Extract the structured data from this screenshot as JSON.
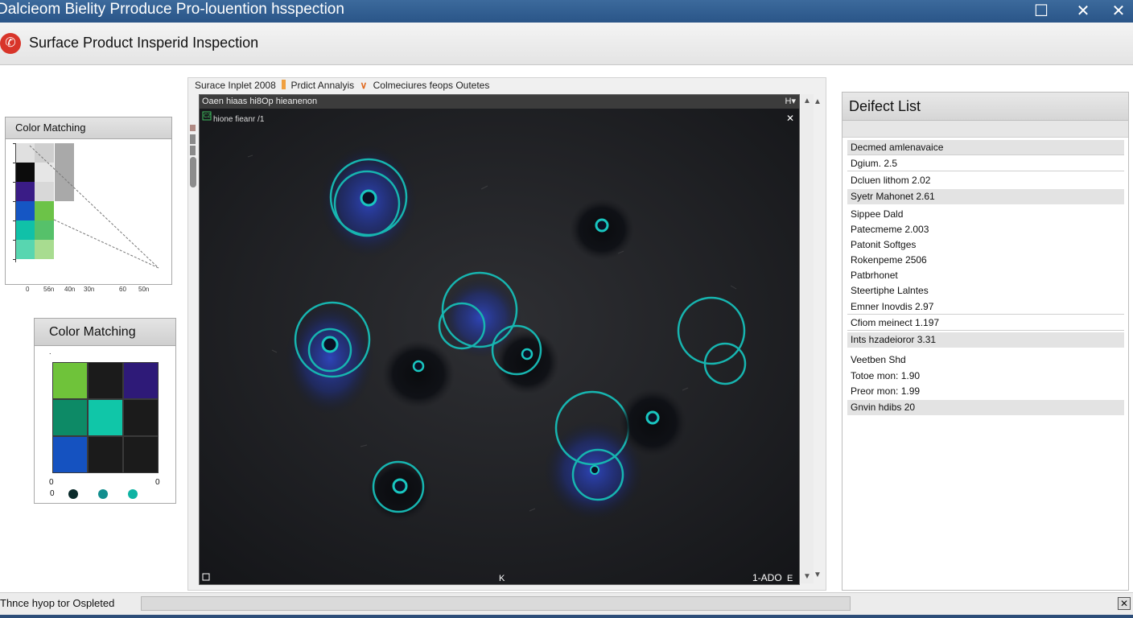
{
  "window": {
    "title": "Dalcieom Bielity Prroduce Pro-louention hsspection",
    "controls": {
      "maximize": "☐",
      "minimize": "✕",
      "close": "✕"
    }
  },
  "app": {
    "title": "Surface Product Insperid Inspection",
    "logo_icon": "phone-icon"
  },
  "color_matching_1": {
    "header": "Color Matching",
    "x_labels": [
      "0",
      "56n",
      "40n",
      "30n",
      "60",
      "50n"
    ],
    "swatches": [
      [
        "#e0e0e0",
        "#cfcfcf"
      ],
      [
        "#0c0c0c",
        "#e6e6e6"
      ],
      [
        "#3a1c86",
        "#d8d8d8"
      ],
      [
        "#1556c4",
        "#6cc348"
      ],
      [
        "#10c1a8",
        "#56c16a"
      ],
      [
        "#58d6b0",
        "#a8dc90"
      ]
    ]
  },
  "color_matching_2": {
    "header": "Color Matching",
    "axis_labels": {
      "top": ".",
      "bottom_left": "0",
      "bottom_right": "0",
      "row": "0"
    },
    "grid": [
      [
        "#6fc33a",
        "#1b1b1b",
        "#2e1a78"
      ],
      [
        "#0d8a66",
        "#10c6a8",
        "#1b1b1b"
      ],
      [
        "#1552c0",
        "#1b1b1b",
        "#1b1b1b"
      ]
    ],
    "dots": [
      "#0a2a2a",
      "#128e8e",
      "#0fb3a3"
    ]
  },
  "inspection": {
    "breadcrumb_1": "Surace Inplet 2008",
    "breadcrumb_2": "Prdict Annalyis",
    "breadcrumb_3": "Colmeciures feops Outetes",
    "window_title": "Oaen hiaas hi8Op hieanenon",
    "window_controls": "H▾",
    "overlay_label": "hione fieanr /1",
    "overlay_badge": "CZ",
    "footer_right": "1-ADO",
    "footer_center": "K",
    "close_symbol": "✕",
    "footer_right_icon": "E"
  },
  "defect_list": {
    "title": "Deifect List",
    "items": [
      "Decmed amlenavaice",
      "Dgium. 2.5",
      "Dcluen lithom 2.02",
      "Syetr Mahonet 2.61",
      "Sippee Dald",
      "Patecmeme 2.003",
      "Patonit Softges",
      "Rokenpeme 2506",
      "Patbrhonet",
      "Steertiphe Lalntes",
      "Emner Inovdis 2.97",
      "Cfiom meinect 1.197",
      "Ints hzadeioror 3.31",
      "Veetben Shd",
      "Totoe mon: 1.90",
      "Preor mon: 1.99",
      "Gnvin hdibs 20"
    ]
  },
  "status": {
    "text": "Thnce hyop tor Ospleted",
    "progress": 0,
    "close": "✕"
  }
}
